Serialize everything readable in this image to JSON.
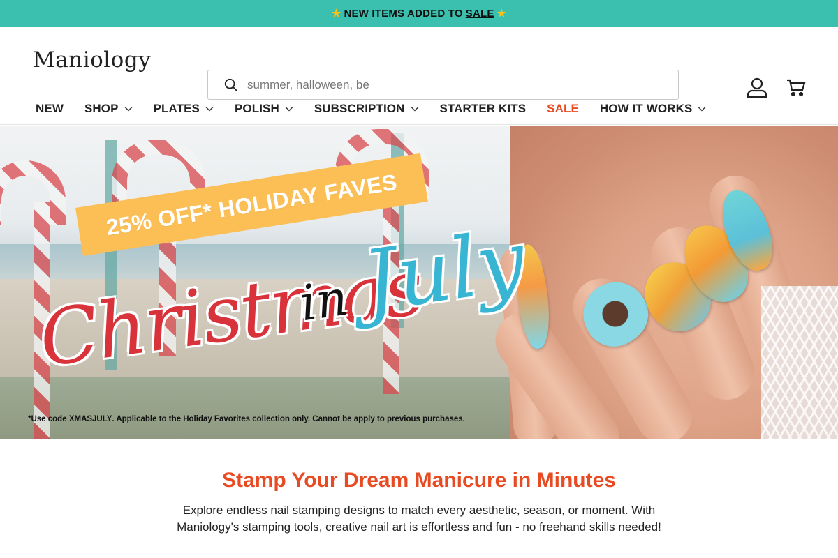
{
  "announcement": {
    "text": "NEW ITEMS ADDED TO",
    "link": "SALE",
    "icon": "star-icon"
  },
  "header": {
    "logo": "Maniology",
    "search": {
      "placeholder": "summer, halloween, be"
    },
    "icons": [
      "search-icon",
      "account-icon",
      "cart-icon"
    ]
  },
  "nav": {
    "items": [
      {
        "label": "NEW",
        "dropdown": false
      },
      {
        "label": "SHOP",
        "dropdown": true
      },
      {
        "label": "PLATES",
        "dropdown": true
      },
      {
        "label": "POLISH",
        "dropdown": true
      },
      {
        "label": "SUBSCRIPTION",
        "dropdown": true
      },
      {
        "label": "STARTER KITS",
        "dropdown": false
      },
      {
        "label": "SALE",
        "dropdown": false,
        "highlight": true
      },
      {
        "label": "HOW IT WORKS",
        "dropdown": true
      }
    ]
  },
  "hero": {
    "banner": "25% OFF* HOLIDAY FAVES",
    "headline_1": "Christmas",
    "headline_2": "in",
    "headline_3": "July",
    "disclaimer_prefix": "*Use code",
    "code": "XMASJULY",
    "disclaimer_suffix": ". Applicable to the Holiday Favorites collection only. Cannot be apply to previous purchases."
  },
  "intro": {
    "title": "Stamp Your Dream Manicure in Minutes",
    "body": "Explore endless nail stamping designs to match every aesthetic, season, or moment. With Maniology's stamping tools, creative nail art is effortless and fun - no freehand skills needed!"
  },
  "colors": {
    "announce_bg": "#3bbfae",
    "accent": "#e84a22",
    "banner": "#fbbf55",
    "script_red": "#d8323a",
    "script_blue": "#37b5d3"
  }
}
